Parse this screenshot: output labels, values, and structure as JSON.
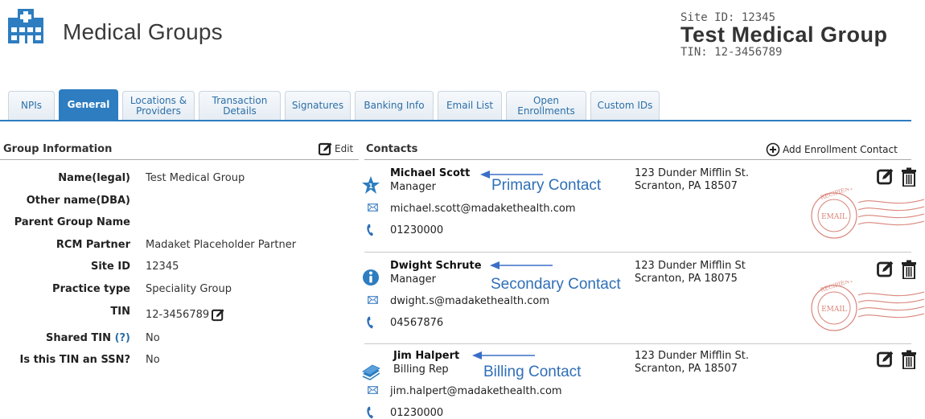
{
  "header": {
    "title": "Medical Groups",
    "site_id": "Site ID: 12345",
    "group_name": "Test Medical Group",
    "tin": "TIN: 12-3456789",
    "icon": "hospital-building-icon"
  },
  "tabs": [
    {
      "label": "NPIs",
      "active": false
    },
    {
      "label": "General",
      "active": true
    },
    {
      "label": "Locations &\nProviders",
      "active": false
    },
    {
      "label": "Transaction\nDetails",
      "active": false
    },
    {
      "label": "Signatures",
      "active": false
    },
    {
      "label": "Banking Info",
      "active": false
    },
    {
      "label": "Email List",
      "active": false
    },
    {
      "label": "Open\nEnrollments",
      "active": false
    },
    {
      "label": "Custom IDs",
      "active": false
    }
  ],
  "group_info": {
    "heading": "Group Information",
    "edit_label": "Edit",
    "fields": [
      {
        "label": "Name(legal)",
        "value": "Test Medical Group"
      },
      {
        "label": "Other name(DBA)",
        "value": ""
      },
      {
        "label": "Parent Group Name",
        "value": ""
      },
      {
        "label": "RCM Partner",
        "value": "Madaket Placeholder Partner"
      },
      {
        "label": "Site ID",
        "value": "12345"
      },
      {
        "label": "Practice type",
        "value": "Speciality Group"
      },
      {
        "label": "TIN",
        "value": "12-3456789"
      },
      {
        "label": "Shared TIN",
        "help": "(?)",
        "value": "No"
      },
      {
        "label": "Is this TIN an SSN?",
        "value": "No"
      }
    ]
  },
  "contacts": {
    "heading": "Contacts",
    "add_label": "Add Enrollment Contact",
    "stamp_text": "EMAIL",
    "stamp_ring": "RECIPIENT",
    "items": [
      {
        "name": "Michael Scott",
        "title": "Manager",
        "email": "michael.scott@madakethealth.com",
        "phone": "01230000",
        "address_line1": "123 Dunder Mifflin St.",
        "address_line2": "Scranton, PA 18507",
        "annotation": "Primary Contact",
        "icon": "primary-star-icon",
        "stamp": true
      },
      {
        "name": "Dwight Schrute",
        "title": "Manager",
        "email": "dwight.s@madakethealth.com",
        "phone": "04567876",
        "address_line1": "123 Dunder Mifflin St",
        "address_line2": "Scranton, PA 18075",
        "annotation": "Secondary Contact",
        "icon": "info-circle-icon",
        "stamp": true
      },
      {
        "name": "Jim Halpert",
        "title": "Billing Rep",
        "email": "jim.halpert@madakethealth.com",
        "phone": "01230000",
        "address_line1": "123 Dunder Mifflin St.",
        "address_line2": "Scranton, PA 18507",
        "annotation": "Billing Contact",
        "icon": "billing-money-icon",
        "stamp": false
      }
    ]
  },
  "colors": {
    "tab_active": "#2d7dc0",
    "tab_text": "#2c6fa8",
    "annotation": "#2f6fb7",
    "stamp": "#d9857a"
  }
}
